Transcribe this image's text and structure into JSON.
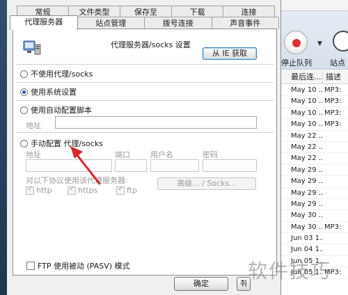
{
  "dialog": {
    "tabs_back": [
      "常规",
      "文件类型",
      "保存至",
      "下载",
      "连接"
    ],
    "tabs_front": [
      "代理服务器",
      "站点管理",
      "拨号连接",
      "声音事件"
    ],
    "active_tab": "代理服务器",
    "settings_title": "代理服务器/socks 设置",
    "ie_button": "从 IE 获取",
    "options": {
      "no_proxy": "不使用代理/socks",
      "system": "使用系统设置",
      "auto_script": "使用自动配置脚本",
      "manual": "手动配置 代理/socks"
    },
    "selected_option": "system",
    "auto_address_label": "地址",
    "manual_fields": {
      "address": "地址",
      "port": "端口",
      "username": "用户名",
      "password": "密码"
    },
    "protocols_label": "对以下协议使用该代理服务器:",
    "protocols": [
      "http",
      "https",
      "ftp"
    ],
    "advanced_button": "高级... / Socks...",
    "pasv_label": "FTP 使用被动 (PASV) 模式",
    "ok_button": "确定",
    "next_button_partial": "취"
  },
  "background_window": {
    "stop_queue_label": "停止队列",
    "site_label": "站点",
    "columns": [
      "最后连...",
      "描述"
    ],
    "rows": [
      {
        "date": "May 10 ...",
        "desc": "MP3:"
      },
      {
        "date": "May 10 ...",
        "desc": "MP3:"
      },
      {
        "date": "May 10 ...",
        "desc": "MP3:"
      },
      {
        "date": "May 10 ...",
        "desc": "MP3:"
      },
      {
        "date": "May 22 ...",
        "desc": ""
      },
      {
        "date": "May 22 ...",
        "desc": ""
      },
      {
        "date": "May 22 ...",
        "desc": ""
      },
      {
        "date": "May 29 ...",
        "desc": ""
      },
      {
        "date": "May 29 ...",
        "desc": ""
      },
      {
        "date": "May 29 ...",
        "desc": ""
      },
      {
        "date": "May 29 ...",
        "desc": ""
      },
      {
        "date": "May 30 ...",
        "desc": ""
      },
      {
        "date": "May 30 ...",
        "desc": "MP3:"
      },
      {
        "date": "Jun 03 1...",
        "desc": ""
      },
      {
        "date": "Jun 04 1...",
        "desc": ""
      },
      {
        "date": "Jun 05 1...",
        "desc": ""
      },
      {
        "date": "Jun 05 1...",
        "desc": "MP3:"
      }
    ]
  },
  "watermark": "软件技巧",
  "colors": {
    "accent": "#1c57b0",
    "arrow": "#d9262c"
  }
}
